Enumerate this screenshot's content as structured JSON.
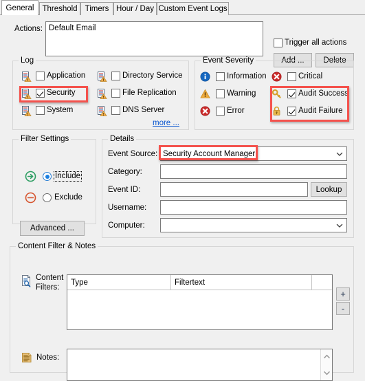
{
  "tabs": [
    {
      "label": "General",
      "active": true
    },
    {
      "label": "Threshold",
      "active": false
    },
    {
      "label": "Timers",
      "active": false
    },
    {
      "label": "Hour / Day",
      "active": false
    },
    {
      "label": "Custom Event Logs",
      "active": false
    }
  ],
  "actions": {
    "label": "Actions:",
    "value": "Default Email",
    "trigger_all_label": "Trigger all actions",
    "trigger_all_checked": false,
    "add_label": "Add ...",
    "delete_label": "Delete"
  },
  "log": {
    "caption": "Log",
    "items": [
      {
        "label": "Application",
        "checked": false,
        "icon": "event-log-icon"
      },
      {
        "label": "Directory Service",
        "checked": false,
        "icon": "event-log-icon"
      },
      {
        "label": "Security",
        "checked": true,
        "icon": "event-log-icon"
      },
      {
        "label": "File Replication",
        "checked": false,
        "icon": "event-log-icon"
      },
      {
        "label": "System",
        "checked": false,
        "icon": "event-log-icon"
      },
      {
        "label": "DNS Server",
        "checked": false,
        "icon": "event-log-icon"
      }
    ],
    "more_label": "more ..."
  },
  "severity": {
    "caption": "Event Severity",
    "items": [
      {
        "label": "Information",
        "checked": false,
        "icon": "information-icon"
      },
      {
        "label": "Critical",
        "checked": false,
        "icon": "critical-icon"
      },
      {
        "label": "Warning",
        "checked": false,
        "icon": "warning-icon"
      },
      {
        "label": "Audit Success",
        "checked": true,
        "icon": "key-icon"
      },
      {
        "label": "Error",
        "checked": false,
        "icon": "error-icon"
      },
      {
        "label": "Audit Failure",
        "checked": true,
        "icon": "lock-icon"
      }
    ]
  },
  "filter_settings": {
    "caption": "Filter Settings",
    "include_label": "Include",
    "exclude_label": "Exclude",
    "selected": "Include",
    "advanced_label": "Advanced ..."
  },
  "details": {
    "caption": "Details",
    "event_source_label": "Event Source:",
    "event_source_value": "Security Account Manager",
    "category_label": "Category:",
    "category_value": "",
    "event_id_label": "Event ID:",
    "event_id_value": "",
    "lookup_label": "Lookup",
    "username_label": "Username:",
    "username_value": "",
    "computer_label": "Computer:",
    "computer_value": ""
  },
  "content_filter": {
    "caption": "Content Filter & Notes",
    "content_filters_label_line1": "Content",
    "content_filters_label_line2": "Filters:",
    "columns": [
      "Type",
      "Filtertext"
    ],
    "rows": [],
    "add_label": "+",
    "remove_label": "-",
    "notes_label": "Notes:",
    "notes_value": ""
  },
  "colors": {
    "highlight": "#f4524d",
    "link": "#0b57d0",
    "accent_blue": "#1a7fe0",
    "panel": "#f0f0f0"
  }
}
